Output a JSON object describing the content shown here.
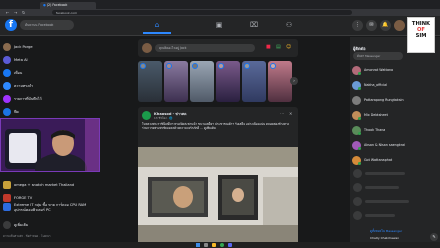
{
  "browser": {
    "tab_title": "(2) Facebook",
    "address": "facebook.com"
  },
  "header": {
    "search_placeholder": "ค้นหาบน Facebook"
  },
  "sidebar": {
    "items": [
      {
        "label": "Jack Porge",
        "color": "#8a6b4e"
      },
      {
        "label": "Meta AI",
        "color": "#5b5bd6"
      },
      {
        "label": "เพื่อน",
        "color": "#1877f2"
      },
      {
        "label": "ความทรงจำ",
        "color": "#2e89ff"
      },
      {
        "label": "รายการที่บันทึกไว้",
        "color": "#a033ff"
      },
      {
        "label": "ฟีด",
        "color": "#1b74e4"
      },
      {
        "label": "ดูเพิ่มเติม",
        "color": "#3a3b3c"
      }
    ],
    "shortcuts": [
      {
        "label": "omega + snatch market Thailand",
        "color": "#c8a13a"
      },
      {
        "label": "FORGE TV",
        "color": "#c0392b"
      },
      {
        "label": "Extreme IT กลุ่ม ซื้อ ขาย การ์ดจอ CPU RAM อุปกรณ์คอมพิวเตอร์ PC",
        "color": "#2d6cdf"
      },
      {
        "label": "ดูเพิ่มเติม",
        "color": "#3a3b3c"
      }
    ],
    "footer": "ความเป็นส่วนตัว · ข้อกำหนด · โฆษณา"
  },
  "feed": {
    "composer_placeholder": "คุณคิดอะไรอยู่ Jack",
    "post": {
      "author": "Khaosod - ข่าวสด",
      "meta": "13 ชั่วโมง · 🌐",
      "text": "ในหลวงพระราชินีเสด็จฯ ทรงเปิดสะพานน้ำ ขบวนเสด็จฯ ประชาชนเฝ้าฯ รับเสด็จ อย่างเนืองแน่น ตลอดสองข้างทาง ร่วมถวายพระพรชัยมงคลด้วยความจงรักภักดี ... ดูเพิ่มเติม"
    }
  },
  "contacts": {
    "title": "ผู้ติดต่อ",
    "search_placeholder": "ค้นหา Messenger",
    "items": [
      {
        "name": "Amonrat Wattana",
        "color": "#b36b7a",
        "online": true
      },
      {
        "name": "Nakha_official",
        "color": "#6b9bd6",
        "online": true
      },
      {
        "name": "Pattarapong Rungtaksin",
        "color": "#7d7d7d",
        "online": false
      },
      {
        "name": "Mix Debtsheet",
        "color": "#c28e5a",
        "online": true
      },
      {
        "name": "Thook Thana",
        "color": "#5a8c5a",
        "online": true
      },
      {
        "name": "Aksan & Nisan saengkrai",
        "color": "#a05ab8",
        "online": true
      },
      {
        "name": "Got Wattanaphat",
        "color": "#d68b3a",
        "online": true
      }
    ],
    "footer": "ดูทั้งหมดใน Messenger",
    "footer_user": "Chaity Chatchawan"
  },
  "logo": {
    "line1": "THINK",
    "line2": "OF",
    "line3": "SIM"
  }
}
